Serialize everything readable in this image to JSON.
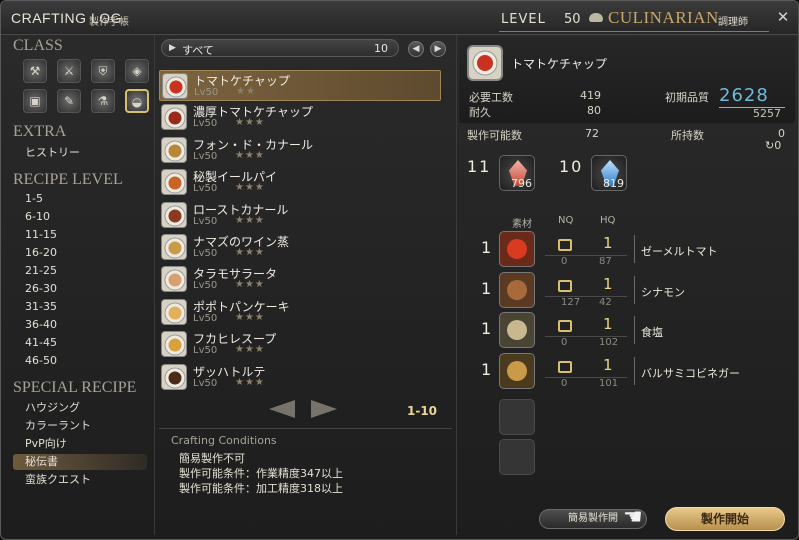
{
  "header": {
    "title": "CRAFTING LOG",
    "subtitle": "製作手帳",
    "level_label": "LEVEL",
    "level_value": "50",
    "job": "CULINARIAN",
    "job_jp": "調理師"
  },
  "sidebar": {
    "class_title": "CLASS",
    "extra_title": "EXTRA",
    "extra_items": [
      "ヒストリー"
    ],
    "recipe_level_title": "RECIPE LEVEL",
    "levels": [
      "1-5",
      "6-10",
      "11-15",
      "16-20",
      "21-25",
      "26-30",
      "31-35",
      "36-40",
      "41-45",
      "46-50"
    ],
    "special_title": "SPECIAL RECIPE",
    "special_items": [
      "ハウジング",
      "カラーラント",
      "PvP向け",
      "秘伝書",
      "蛮族クエスト"
    ],
    "selected_special": "秘伝書"
  },
  "filter": {
    "label": "すべて",
    "count": "10"
  },
  "recipes": [
    {
      "name": "トマトケチャップ",
      "lv": "Lv50",
      "stars": "★★"
    },
    {
      "name": "濃厚トマトケチャップ",
      "lv": "Lv50",
      "stars": "★★★"
    },
    {
      "name": "フォン・ド・カナール",
      "lv": "Lv50",
      "stars": "★★★"
    },
    {
      "name": "秘製イールパイ",
      "lv": "Lv50",
      "stars": "★★★"
    },
    {
      "name": "ローストカナール",
      "lv": "Lv50",
      "stars": "★★★"
    },
    {
      "name": "ナマズのワイン蒸",
      "lv": "Lv50",
      "stars": "★★★"
    },
    {
      "name": "タラモサラータ",
      "lv": "Lv50",
      "stars": "★★★"
    },
    {
      "name": "ポポトパンケーキ",
      "lv": "Lv50",
      "stars": "★★★"
    },
    {
      "name": "フカヒレスープ",
      "lv": "Lv50",
      "stars": "★★★"
    },
    {
      "name": "ザッハトルテ",
      "lv": "Lv50",
      "stars": "★★★"
    }
  ],
  "page_range": "1-10",
  "conditions": {
    "title": "Crafting Conditions",
    "lines": [
      "簡易製作不可",
      "製作可能条件：作業精度347以上",
      "製作可能条件：加工精度318以上"
    ]
  },
  "detail": {
    "name": "トマトケチャップ",
    "required_work_label": "必要工数",
    "required_work": "419",
    "durability_label": "耐久",
    "durability": "80",
    "initial_quality_label": "初期品質",
    "quality": "2628",
    "quality_max": "5257",
    "craftable_label": "製作可能数",
    "craftable": "72",
    "owned_label": "所持数",
    "owned": "0",
    "recycle": "0",
    "crystals": [
      {
        "need": "11",
        "have": "796",
        "color": "#e07a6a"
      },
      {
        "need": "10",
        "have": "819",
        "color": "#5aa6e8"
      }
    ],
    "mat_header": "素材",
    "nq_header": "NQ",
    "hq_header": "HQ",
    "materials": [
      {
        "need": "1",
        "hq": "1",
        "nq_have": "0",
        "hq_have": "87",
        "name": "ゼーメルトマト"
      },
      {
        "need": "1",
        "hq": "1",
        "nq_have": "127",
        "hq_have": "42",
        "name": "シナモン"
      },
      {
        "need": "1",
        "hq": "1",
        "nq_have": "0",
        "hq_have": "102",
        "name": "食塩"
      },
      {
        "need": "1",
        "hq": "1",
        "nq_have": "0",
        "hq_have": "101",
        "name": "バルサミコビネガー"
      }
    ]
  },
  "buttons": {
    "quick_synth": "簡易製作開",
    "synthesize": "製作開始"
  },
  "colors": {
    "accent": "#c9a86a",
    "quality": "#6fb9d9",
    "selected_row": "#7d6440"
  }
}
